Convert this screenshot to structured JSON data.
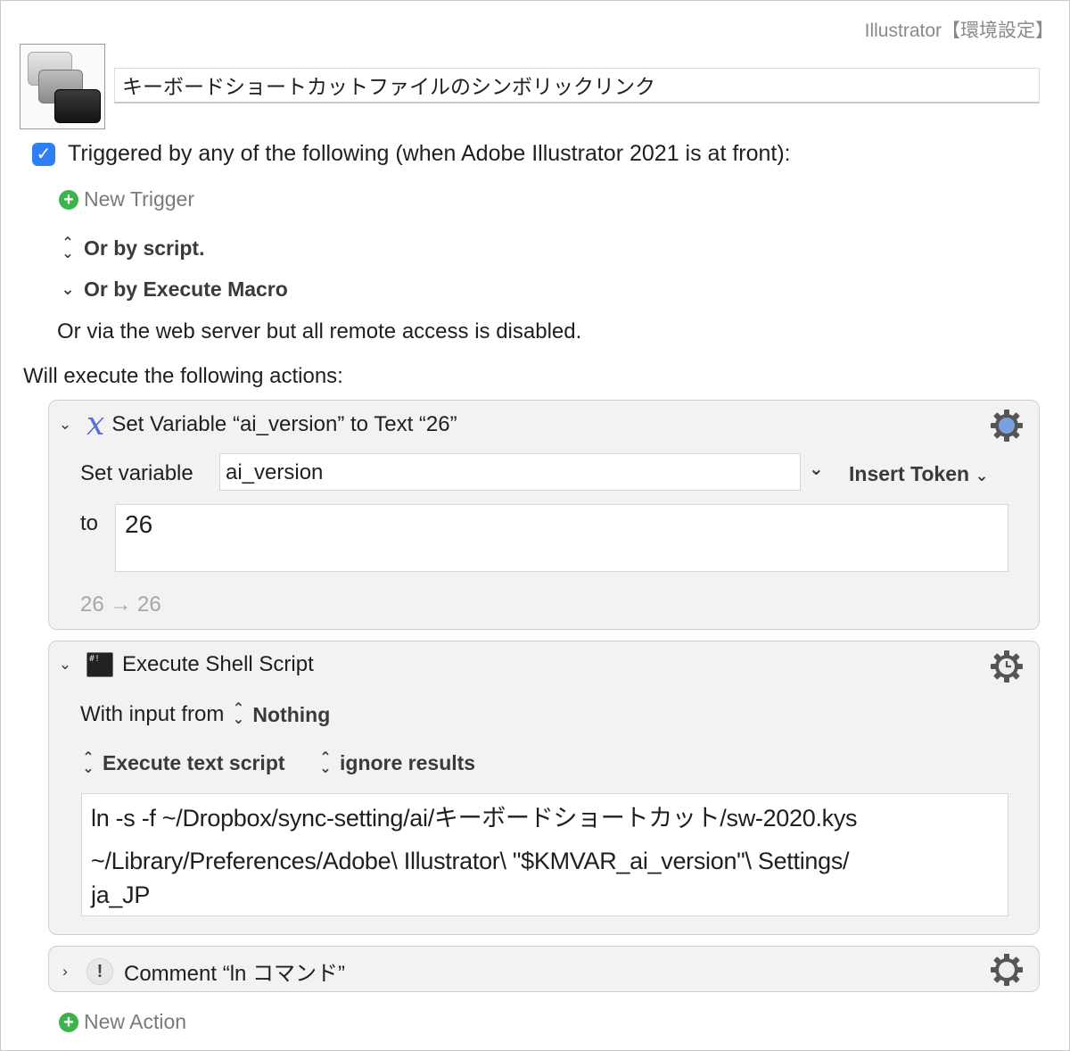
{
  "group_label": "Illustrator【環境設定】",
  "macro": {
    "name": "キーボードショートカットファイルのシンボリックリンク"
  },
  "triggers": {
    "checked": true,
    "heading": "Triggered by any of the following (when Adobe Illustrator 2021 is at front):",
    "new_trigger": "New Trigger",
    "or_script": "Or by script.",
    "or_execute_macro": "Or by Execute Macro",
    "web_server": "Or via the web server but all remote access is disabled."
  },
  "actions_heading": "Will execute the following actions:",
  "actions": [
    {
      "title": "Set Variable “ai_version” to Text “26”",
      "set_variable_label": "Set variable",
      "variable_value": "ai_version",
      "insert_token": "Insert Token",
      "to_label": "to",
      "text_value": "26",
      "preview": "26 → 26"
    },
    {
      "title": "Execute Shell Script",
      "input_label": "With input from",
      "input_value": "Nothing",
      "execute_mode": "Execute text script",
      "results_mode": "ignore results",
      "script_line1": "ln -s -f ~/Dropbox/sync-setting/ai/キーボードショートカット/sw-2020.kys",
      "script_line2": "~/Library/Preferences/Adobe\\ Illustrator\\ \"$KMVAR_ai_version\"\\ Settings/",
      "script_line3": "ja_JP"
    },
    {
      "title": "Comment “ln コマンド”"
    }
  ],
  "new_action": "New Action",
  "colors": {
    "accent": "#2f80f5",
    "add_green": "#3bb54a",
    "panel": "#f2f2f2"
  }
}
